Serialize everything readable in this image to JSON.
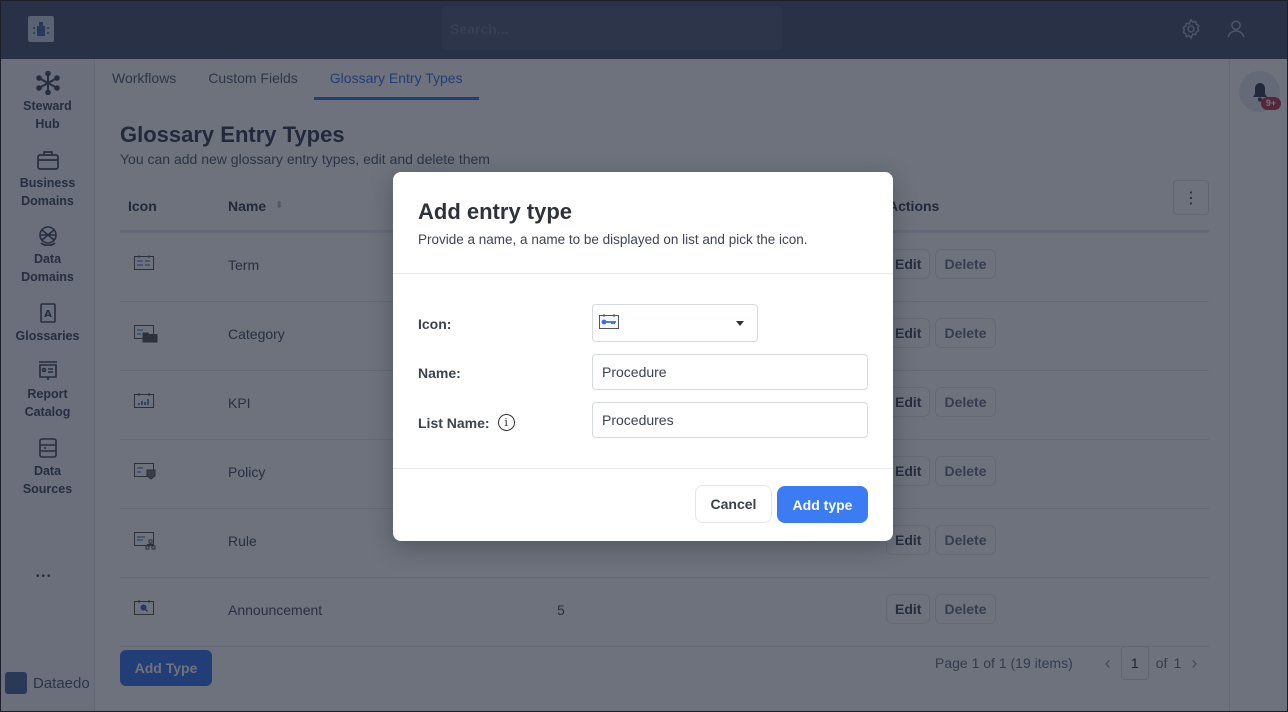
{
  "topbar": {
    "search_placeholder": "Search...",
    "icons": [
      "app-logo-icon",
      "settings-gear-icon",
      "user-icon"
    ]
  },
  "sidebar": {
    "items": [
      {
        "label_line1": "Steward",
        "label_line2": "Hub",
        "icon": "snowflake-hub-icon"
      },
      {
        "label_line1": "Business",
        "label_line2": "Domains",
        "icon": "briefcase-icon"
      },
      {
        "label_line1": "Data",
        "label_line2": "Domains",
        "icon": "globe-icon"
      },
      {
        "label_line1": "Glossaries",
        "label_line2": "",
        "icon": "glossary-book-icon"
      },
      {
        "label_line1": "Report",
        "label_line2": "Catalog",
        "icon": "report-board-icon"
      },
      {
        "label_line1": "Data",
        "label_line2": "Sources",
        "icon": "database-icon"
      }
    ],
    "more_label": "•••",
    "brand_name": "Dataedo"
  },
  "tabs": [
    {
      "label": "Workflows",
      "active": false
    },
    {
      "label": "Custom Fields",
      "active": false
    },
    {
      "label": "Glossary Entry Types",
      "active": true
    }
  ],
  "page": {
    "title": "Glossary Entry Types",
    "subtitle": "You can add new glossary entry types, edit and delete them"
  },
  "table": {
    "columns": {
      "icon": "Icon",
      "name": "Name",
      "actions": "Actions"
    },
    "rows": [
      {
        "icon": "term-icon",
        "name": "Term",
        "count": ""
      },
      {
        "icon": "category-icon",
        "name": "Category",
        "count": ""
      },
      {
        "icon": "kpi-icon",
        "name": "KPI",
        "count": ""
      },
      {
        "icon": "policy-icon",
        "name": "Policy",
        "count": ""
      },
      {
        "icon": "rule-icon",
        "name": "Rule",
        "count": ""
      },
      {
        "icon": "announcement-icon",
        "name": "Announcement",
        "count": "5"
      }
    ],
    "edit_label": "Edit",
    "delete_label": "Delete"
  },
  "add_type_button": "Add Type",
  "pagination": {
    "summary": "Page 1 of 1 (19 items)",
    "current_page": "1",
    "of_label": "of",
    "total_pages": "1"
  },
  "notifications": {
    "badge": "9+"
  },
  "modal": {
    "title": "Add entry type",
    "subtitle": "Provide a name, a name to be displayed on list and pick the icon.",
    "icon_label": "Icon:",
    "selected_icon": "procedure-key-icon",
    "name_label": "Name:",
    "name_value": "Procedure",
    "list_name_label": "List Name:",
    "list_name_value": "Procedures",
    "info_glyph": "i",
    "cancel_label": "Cancel",
    "submit_label": "Add type"
  },
  "colors": {
    "accent": "#3b7cf5",
    "topbar": "#4a5670",
    "badge": "#c23a4e"
  }
}
